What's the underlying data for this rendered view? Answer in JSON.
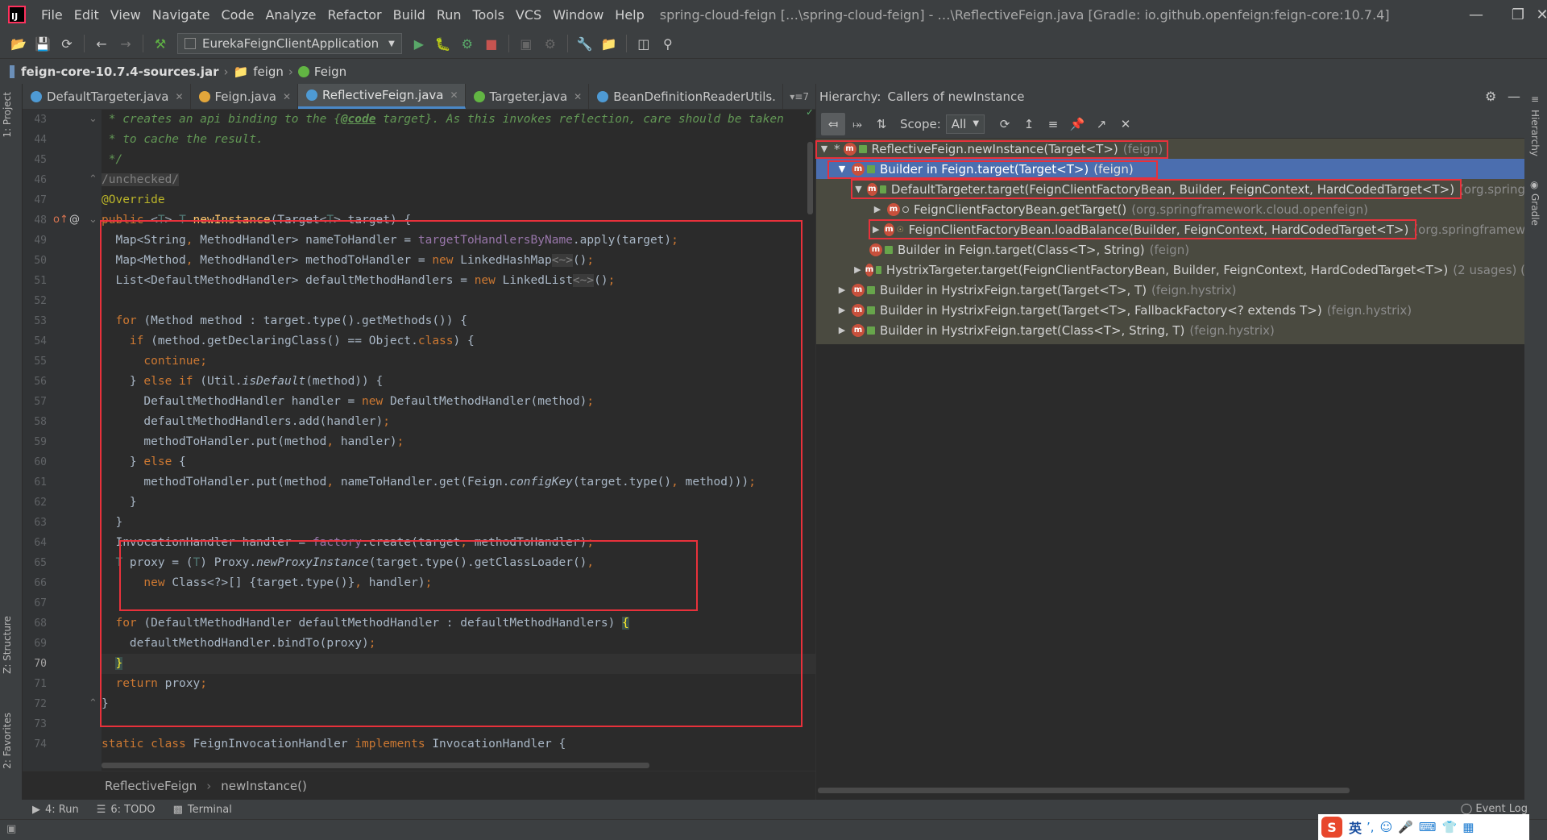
{
  "window": {
    "title": "spring-cloud-feign […\\spring-cloud-feign] - …\\ReflectiveFeign.java [Gradle: io.github.openfeign:feign-core:10.7.4]",
    "logo": "IJ"
  },
  "menu": [
    "File",
    "Edit",
    "View",
    "Navigate",
    "Code",
    "Analyze",
    "Refactor",
    "Build",
    "Run",
    "Tools",
    "VCS",
    "Window",
    "Help"
  ],
  "toolbar": {
    "run_config": "EurekaFeignClientApplication"
  },
  "breadcrumb": {
    "jar": "feign-core-10.7.4-sources.jar",
    "package": "feign",
    "class": "Feign"
  },
  "left_stripe": {
    "project": "1: Project",
    "structure": "Z: Structure",
    "favorites": "2: Favorites"
  },
  "right_stripe": {
    "hierarchy": "Hierarchy",
    "gradle": "Gradle"
  },
  "editor_tabs": [
    {
      "label": "DefaultTargeter.java",
      "color": "#4e9ad4"
    },
    {
      "label": "Feign.java",
      "color": "#e2a63b"
    },
    {
      "label": "ReflectiveFeign.java",
      "color": "#4e9ad4"
    },
    {
      "label": "Targeter.java",
      "color": "#62b543"
    },
    {
      "label": "BeanDefinitionReaderUtils.",
      "color": "#4e9ad4"
    }
  ],
  "tabs_overflow": "7",
  "editor": {
    "line_numbers": [
      "43",
      "44",
      "45",
      "46",
      "47",
      "48",
      "49",
      "50",
      "51",
      "52",
      "53",
      "54",
      "55",
      "56",
      "57",
      "58",
      "59",
      "60",
      "61",
      "62",
      "63",
      "64",
      "65",
      "66",
      "67",
      "68",
      "69",
      "70",
      "71",
      "72",
      "73",
      "74"
    ],
    "current_line": "70"
  },
  "editor_crumbs": {
    "class": "ReflectiveFeign",
    "method": "newInstance()"
  },
  "hierarchy": {
    "title": "Hierarchy:",
    "subtitle": "Callers of newInstance",
    "scope_label": "Scope:",
    "scope_value": "All",
    "nodes": [
      {
        "text": "ReflectiveFeign.newInstance(Target<T>)",
        "pkg": "(feign)"
      },
      {
        "text": "Builder in Feign.target(Target<T>)",
        "pkg": "(feign)"
      },
      {
        "text": "DefaultTargeter.target(FeignClientFactoryBean, Builder, FeignContext, HardCodedTarget<T>)",
        "pkg": "(org.spring"
      },
      {
        "text": "FeignClientFactoryBean.getTarget()",
        "pkg": "(org.springframework.cloud.openfeign)"
      },
      {
        "text": "FeignClientFactoryBean.loadBalance(Builder, FeignContext, HardCodedTarget<T>)",
        "pkg": "(org.springframew"
      },
      {
        "text": "Builder in Feign.target(Class<T>, String)",
        "pkg": "(feign)"
      },
      {
        "text": "HystrixTargeter.target(FeignClientFactoryBean, Builder, FeignContext, HardCodedTarget<T>)",
        "pkg": "(2 usages)  ("
      },
      {
        "text": "Builder in HystrixFeign.target(Target<T>, T)",
        "pkg": "(feign.hystrix)"
      },
      {
        "text": "Builder in HystrixFeign.target(Target<T>, FallbackFactory<? extends T>)",
        "pkg": "(feign.hystrix)"
      },
      {
        "text": "Builder in HystrixFeign.target(Class<T>, String, T)",
        "pkg": "(feign.hystrix)"
      }
    ]
  },
  "bottom_bar": {
    "run": "4: Run",
    "todo": "6: TODO",
    "terminal": "Terminal",
    "event_log": "Event Log"
  },
  "ime": {
    "label": "英"
  }
}
